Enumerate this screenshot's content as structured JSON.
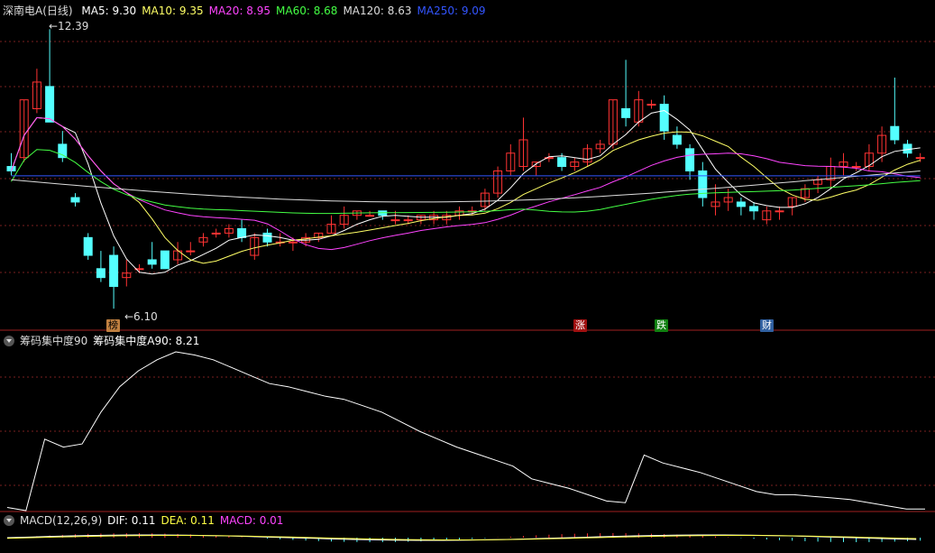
{
  "main_panel": {
    "stock_name": "深南电A(日线)",
    "ma": [
      {
        "label": "MA5: 9.30",
        "color": "#ffffff"
      },
      {
        "label": "MA10: 9.35",
        "color": "#ffff66"
      },
      {
        "label": "MA20: 8.95",
        "color": "#ff44ff"
      },
      {
        "label": "MA60: 8.68",
        "color": "#44ff44"
      },
      {
        "label": "MA120: 8.63",
        "color": "#dddddd"
      },
      {
        "label": "MA250: 9.09",
        "color": "#3355ff"
      }
    ],
    "high_label": "12.39",
    "low_label": "6.10",
    "tags": [
      {
        "text": "榜",
        "bg": "#c08040",
        "fg": "#000000"
      },
      {
        "text": "涨",
        "bg": "#a01010",
        "fg": "#ffffff"
      },
      {
        "text": "跌",
        "bg": "#108010",
        "fg": "#ffffff"
      },
      {
        "text": "财",
        "bg": "#3060a0",
        "fg": "#ffffff"
      }
    ],
    "up_color": "#ff3333",
    "down_color": "#54ffff"
  },
  "chip_panel": {
    "title": "筹码集中度90",
    "value_label": "筹码集中度A90: 8.21",
    "line_color": "#ffffff"
  },
  "macd_panel": {
    "title": "MACD(12,26,9)",
    "dif": "DIF: 0.11",
    "dea": "DEA: 0.11",
    "macd": "MACD: 0.01",
    "dif_color": "#ffffff",
    "dea_color": "#ffff44",
    "macd_color": "#ff44ff"
  },
  "chart_data": {
    "type": "candlestick",
    "candles": [
      [
        9.3,
        9.6,
        9.2,
        9.1
      ],
      [
        9.5,
        10.8,
        10.8,
        9.4
      ],
      [
        10.6,
        11.5,
        11.2,
        10.5
      ],
      [
        11.1,
        12.39,
        10.3,
        10.3
      ],
      [
        9.8,
        10.1,
        9.5,
        9.4
      ],
      [
        8.6,
        8.7,
        8.5,
        8.4
      ],
      [
        7.7,
        7.8,
        7.3,
        7.2
      ],
      [
        7.0,
        7.4,
        6.8,
        6.7
      ],
      [
        7.3,
        7.5,
        6.6,
        6.1
      ],
      [
        6.8,
        7.2,
        6.9,
        6.6
      ],
      [
        7.0,
        7.1,
        7.0,
        6.9
      ],
      [
        7.2,
        7.6,
        7.1,
        7.0
      ],
      [
        7.4,
        7.4,
        7.0,
        7.0
      ],
      [
        7.2,
        7.6,
        7.4,
        7.1
      ],
      [
        7.4,
        7.6,
        7.4,
        7.3
      ],
      [
        7.6,
        7.8,
        7.7,
        7.5
      ],
      [
        7.8,
        7.9,
        7.8,
        7.7
      ],
      [
        7.8,
        8.0,
        7.9,
        7.7
      ],
      [
        7.9,
        8.1,
        7.7,
        7.6
      ],
      [
        7.3,
        7.8,
        7.7,
        7.2
      ],
      [
        7.8,
        7.9,
        7.6,
        7.5
      ],
      [
        7.6,
        7.8,
        7.6,
        7.5
      ],
      [
        7.6,
        7.7,
        7.6,
        7.4
      ],
      [
        7.6,
        7.8,
        7.7,
        7.5
      ],
      [
        7.7,
        7.8,
        7.8,
        7.6
      ],
      [
        7.8,
        8.2,
        8.0,
        7.8
      ],
      [
        8.0,
        8.4,
        8.2,
        7.9
      ],
      [
        8.2,
        8.3,
        8.3,
        8.1
      ],
      [
        8.2,
        8.3,
        8.2,
        8.2
      ],
      [
        8.3,
        8.3,
        8.2,
        8.1
      ],
      [
        8.1,
        8.3,
        8.1,
        8.0
      ],
      [
        8.1,
        8.2,
        8.1,
        8.0
      ],
      [
        8.1,
        8.2,
        8.2,
        8.0
      ],
      [
        8.1,
        8.3,
        8.2,
        8.0
      ],
      [
        8.1,
        8.3,
        8.2,
        8.0
      ],
      [
        8.2,
        8.4,
        8.3,
        8.1
      ],
      [
        8.3,
        8.4,
        8.3,
        8.2
      ],
      [
        8.4,
        8.8,
        8.7,
        8.3
      ],
      [
        8.7,
        9.3,
        9.2,
        8.6
      ],
      [
        9.2,
        9.8,
        9.6,
        9.1
      ],
      [
        9.3,
        10.4,
        9.9,
        9.2
      ],
      [
        9.3,
        9.4,
        9.4,
        9.1
      ],
      [
        9.5,
        9.6,
        9.5,
        9.4
      ],
      [
        9.5,
        9.6,
        9.3,
        9.2
      ],
      [
        9.3,
        9.5,
        9.4,
        9.2
      ],
      [
        9.4,
        9.8,
        9.7,
        9.3
      ],
      [
        9.7,
        9.9,
        9.8,
        9.6
      ],
      [
        9.8,
        10.8,
        10.8,
        9.7
      ],
      [
        10.6,
        11.7,
        10.4,
        10.2
      ],
      [
        10.3,
        11.0,
        10.8,
        10.2
      ],
      [
        10.7,
        10.8,
        10.7,
        10.6
      ],
      [
        10.7,
        10.9,
        10.1,
        9.9
      ],
      [
        10.0,
        10.2,
        9.8,
        9.7
      ],
      [
        9.7,
        9.8,
        9.2,
        9.0
      ],
      [
        9.2,
        9.4,
        8.6,
        8.4
      ],
      [
        8.4,
        8.9,
        8.5,
        8.2
      ],
      [
        8.5,
        8.8,
        8.6,
        8.3
      ],
      [
        8.5,
        8.6,
        8.4,
        8.2
      ],
      [
        8.4,
        8.5,
        8.3,
        8.1
      ],
      [
        8.1,
        8.4,
        8.3,
        8.0
      ],
      [
        8.3,
        8.4,
        8.3,
        8.1
      ],
      [
        8.4,
        8.6,
        8.6,
        8.2
      ],
      [
        8.6,
        8.9,
        8.8,
        8.5
      ],
      [
        8.9,
        9.1,
        9.0,
        8.7
      ],
      [
        9.0,
        9.5,
        9.3,
        8.8
      ],
      [
        9.3,
        9.6,
        9.4,
        9.1
      ],
      [
        9.3,
        9.4,
        9.3,
        9.2
      ],
      [
        9.3,
        9.8,
        9.6,
        9.2
      ],
      [
        9.6,
        10.2,
        10.0,
        9.4
      ],
      [
        10.2,
        11.3,
        9.9,
        9.8
      ],
      [
        9.8,
        9.9,
        9.6,
        9.5
      ],
      [
        9.5,
        9.6,
        9.5,
        9.4
      ]
    ],
    "high": 12.39,
    "low": 6.1
  }
}
